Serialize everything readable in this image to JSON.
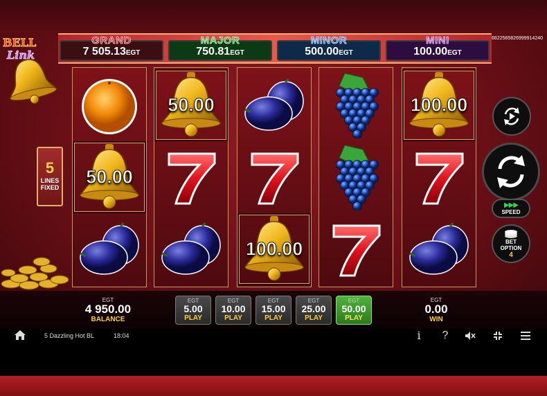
{
  "jackpots": {
    "grand": {
      "name": "GRAND",
      "value": "7 505.13",
      "unit": "EGT"
    },
    "major": {
      "name": "MAJOR",
      "value": "750.81",
      "unit": "EGT"
    },
    "minor": {
      "name": "MINOR",
      "value": "500.00",
      "unit": "EGT"
    },
    "mini": {
      "name": "MINI",
      "value": "100.00",
      "unit": "EGT"
    }
  },
  "game_id": "6822565826999914240",
  "logo": {
    "word1": "BELL",
    "word2": "Link"
  },
  "lines": {
    "count": "5",
    "label1": "LINES",
    "label2": "FIXED"
  },
  "reels": [
    [
      {
        "symbol": "orange"
      },
      {
        "symbol": "bell",
        "value": "50.00"
      },
      {
        "symbol": "plum"
      }
    ],
    [
      {
        "symbol": "bell",
        "value": "50.00"
      },
      {
        "symbol": "seven"
      },
      {
        "symbol": "plum"
      }
    ],
    [
      {
        "symbol": "plum"
      },
      {
        "symbol": "seven"
      },
      {
        "symbol": "bell",
        "value": "100.00"
      }
    ],
    [
      {
        "symbol": "grapes"
      },
      {
        "symbol": "grapes"
      },
      {
        "symbol": "seven"
      }
    ],
    [
      {
        "symbol": "bell",
        "value": "100.00"
      },
      {
        "symbol": "seven"
      },
      {
        "symbol": "plum"
      }
    ]
  ],
  "controls": {
    "autoplay_icon": "autoplay-icon",
    "spin_icon": "spin-icon",
    "speed_label": "SPEED",
    "bet_option_label1": "BET",
    "bet_option_label2": "OPTION",
    "bet_option_value": "4"
  },
  "balance": {
    "currency": "EGT",
    "value": "4 950.00",
    "label": "BALANCE"
  },
  "win": {
    "currency": "EGT",
    "value": "0.00",
    "label": "WIN"
  },
  "bets": [
    {
      "currency": "EGT",
      "amount": "5.00",
      "action": "PLAY",
      "active": false
    },
    {
      "currency": "EGT",
      "amount": "10.00",
      "action": "PLAY",
      "active": false
    },
    {
      "currency": "EGT",
      "amount": "15.00",
      "action": "PLAY",
      "active": false
    },
    {
      "currency": "EGT",
      "amount": "25.00",
      "action": "PLAY",
      "active": false
    },
    {
      "currency": "EGT",
      "amount": "50.00",
      "action": "PLAY",
      "active": true
    }
  ],
  "system": {
    "game_name": "5 Dazzling Hot BL",
    "time": "18:04",
    "info_glyph": "i",
    "help_glyph": "?",
    "icons": [
      "home-icon",
      "info-icon",
      "help-icon",
      "mute-icon",
      "fullscreen-icon",
      "menu-icon"
    ]
  },
  "colors": {
    "grand": "#d8202a",
    "major": "#2ec33a",
    "minor": "#3a8ae0",
    "mini": "#b145d4",
    "accent": "#ffcf3a",
    "active_bet": "#4fb43a"
  }
}
